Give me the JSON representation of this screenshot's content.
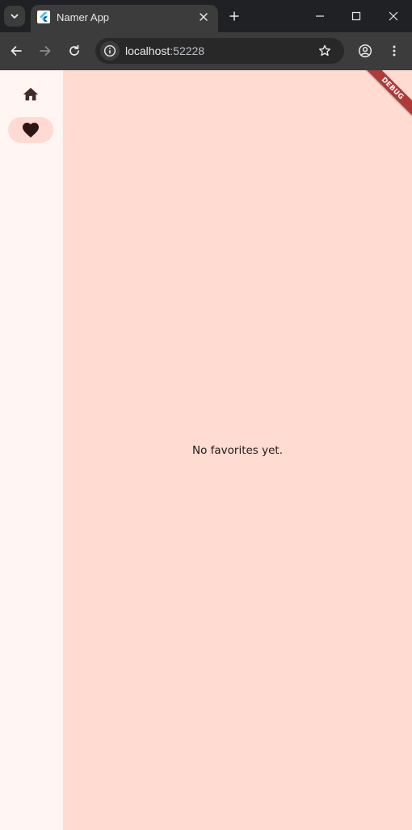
{
  "browser": {
    "tab": {
      "title": "Namer App"
    },
    "address_bar": {
      "host": "localhost",
      "port": ":52228"
    },
    "icons": {
      "tab_search": "chevron-down-icon",
      "favicon": "flutter-logo-icon",
      "tab_close": "close-icon",
      "new_tab": "plus-icon",
      "minimize": "minimize-icon",
      "maximize": "maximize-icon",
      "close_window": "close-icon",
      "back": "arrow-left-icon",
      "forward": "arrow-right-icon",
      "reload": "reload-icon",
      "site_info": "info-icon",
      "bookmark": "star-icon",
      "profile": "account-circle-icon",
      "menu": "more-vert-icon"
    }
  },
  "app": {
    "navigation_rail": {
      "destinations": [
        {
          "icon": "home-icon",
          "selected": false
        },
        {
          "icon": "favorite-icon",
          "selected": true
        }
      ]
    },
    "favorites_page": {
      "empty_message": "No favorites yet."
    },
    "debug_banner": "DEBUG"
  },
  "colors": {
    "rail_background": "#fff5f2",
    "content_background": "#ffdbd2",
    "selected_indicator": "#ffdad2",
    "debug_banner": "#b03a3a"
  }
}
